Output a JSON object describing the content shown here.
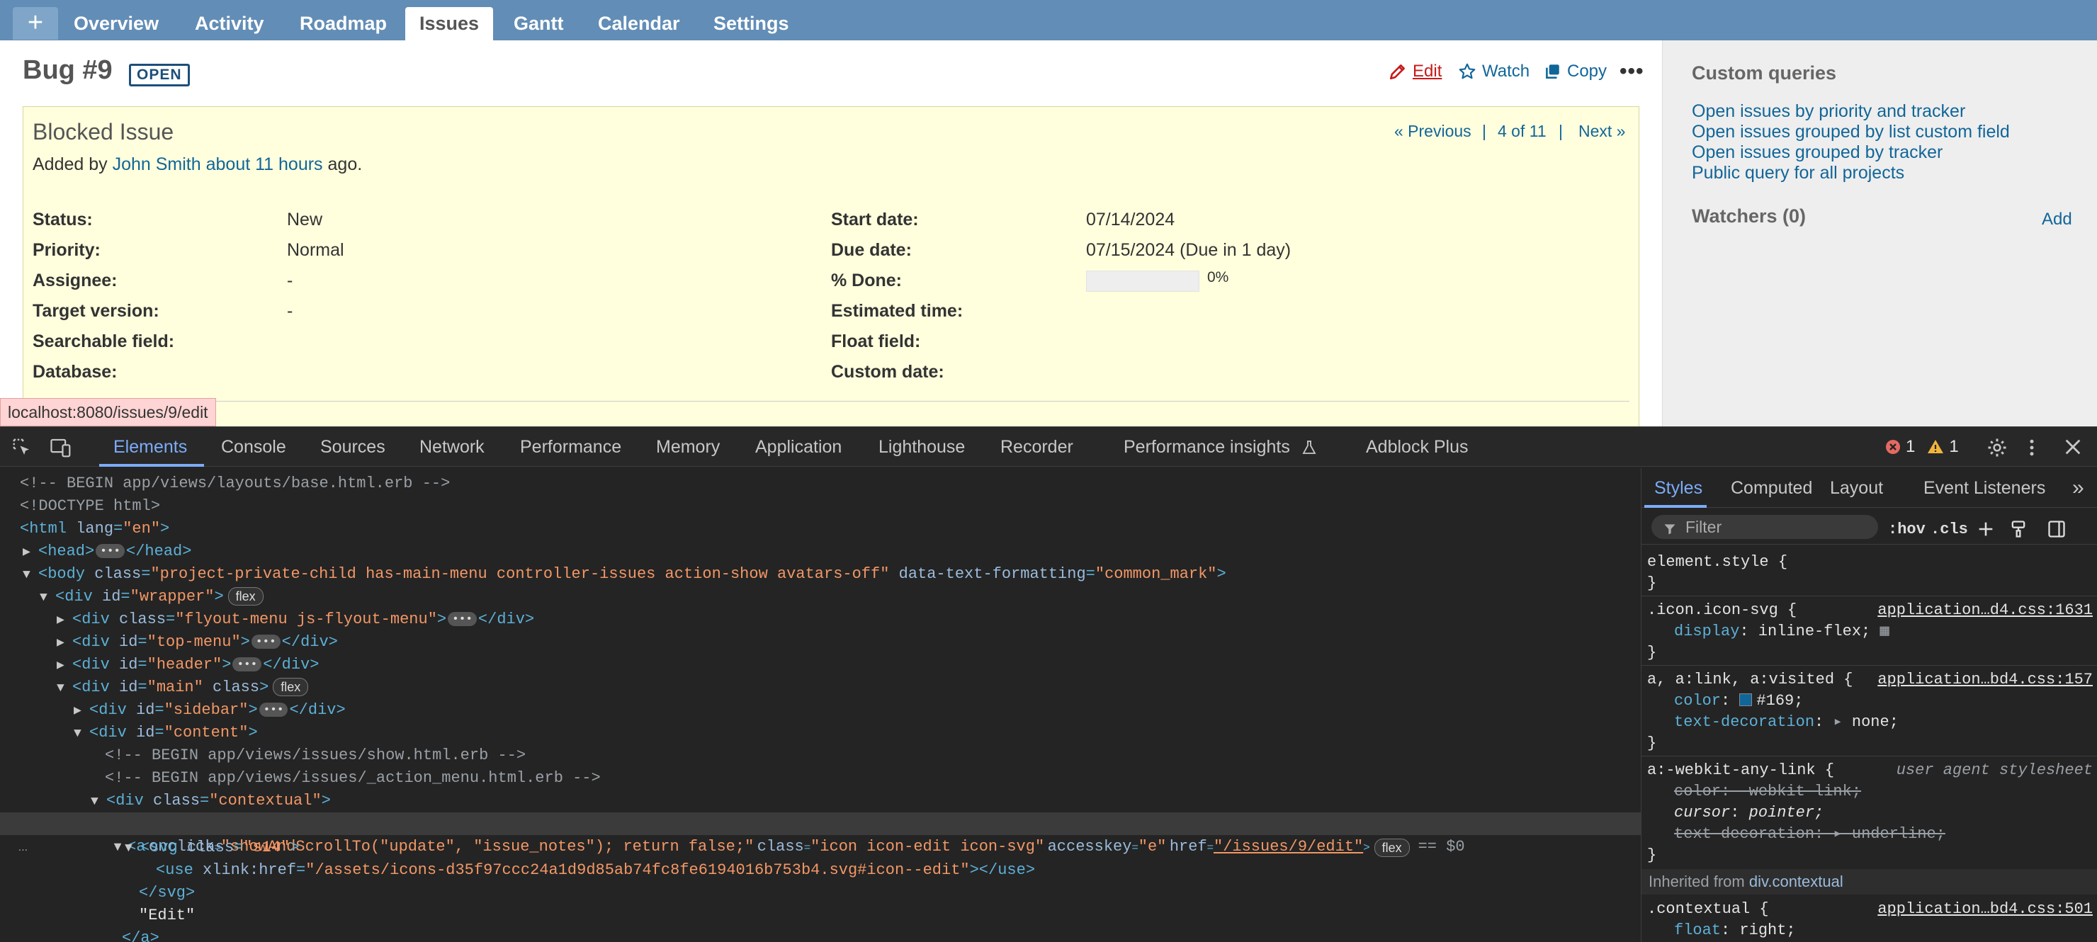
{
  "topmenu": {
    "plus": "+",
    "tabs": [
      "Overview",
      "Activity",
      "Roadmap",
      "Issues",
      "Gantt",
      "Calendar",
      "Settings"
    ],
    "selected": "Issues"
  },
  "issue": {
    "title": "Bug #9",
    "status_badge": "OPEN",
    "subject": "Blocked Issue",
    "added_by_prefix": "Added by",
    "author": "John Smith",
    "age": "about 11 hours",
    "age_suffix": "ago.",
    "actions": {
      "edit": "Edit",
      "watch": "Watch",
      "copy": "Copy",
      "more": "•••"
    },
    "nav": {
      "previous": "« Previous",
      "sep1": "|",
      "position": "4 of 11",
      "sep2": "|",
      "next": "Next »"
    },
    "attributes_left": [
      {
        "label": "Status:",
        "value": "New"
      },
      {
        "label": "Priority:",
        "value": "Normal"
      },
      {
        "label": "Assignee:",
        "value": "-"
      },
      {
        "label": "Target version:",
        "value": "-"
      },
      {
        "label": "Searchable field:",
        "value": ""
      },
      {
        "label": "Database:",
        "value": ""
      }
    ],
    "attributes_right": [
      {
        "label": "Start date:",
        "value": "07/14/2024"
      },
      {
        "label": "Due date:",
        "value": "07/15/2024 (Due in 1 day)"
      },
      {
        "label": "% Done:",
        "value": "0%"
      },
      {
        "label": "Estimated time:",
        "value": ""
      },
      {
        "label": "Float field:",
        "value": ""
      },
      {
        "label": "Custom date:",
        "value": ""
      }
    ],
    "done_fraction": 0
  },
  "sidebar": {
    "queries_heading": "Custom queries",
    "queries": [
      "Open issues by priority and tracker",
      "Open issues grouped by list custom field",
      "Open issues grouped by tracker",
      "Public query for all projects"
    ],
    "watchers_heading": "Watchers (0)",
    "watchers_add": "Add"
  },
  "status_url": "localhost:8080/issues/9/edit",
  "devtools": {
    "tabs": [
      "Elements",
      "Console",
      "Sources",
      "Network",
      "Performance",
      "Memory",
      "Application",
      "Lighthouse",
      "Recorder",
      "Performance insights",
      "Adblock Plus"
    ],
    "selected_tab": "Elements",
    "errors": "1",
    "warnings": "1",
    "dom": {
      "c1": "<!-- BEGIN app/views/layouts/base.html.erb -->",
      "doctype": "<!DOCTYPE html>",
      "html_tag": "<html",
      "html_attr": "lang",
      "html_val": "\"en\"",
      "head": "<head>",
      "head_close": "</head>",
      "body_open": "<body",
      "body_class_attr": "class",
      "body_class_val": "\"project-private-child has-main-menu controller-issues action-show avatars-off\"",
      "body_data_attr": "data-text-formatting",
      "body_data_val": "\"common_mark\"",
      "wrapper": "<div",
      "wrapper_attr": "id",
      "wrapper_val": "\"wrapper\"",
      "flex": "flex",
      "flyout_attr": "class",
      "flyout_val": "\"flyout-menu js-flyout-menu\"",
      "topmenu_val": "\"top-menu\"",
      "header_val": "\"header\"",
      "main_val": "\"main\"",
      "main_class": "class",
      "sidebar_val": "\"sidebar\"",
      "content_val": "\"content\"",
      "c2": "<!-- BEGIN app/views/issues/show.html.erb -->",
      "c3": "<!-- BEGIN app/views/issues/_action_menu.html.erb -->",
      "contextual_val": "\"contextual\"",
      "a_onclick_attr": "onclick",
      "a_onclick_val": "\"showAndScrollTo(\"update\", \"issue_notes\"); return false;\"",
      "a_class_attr": "class",
      "a_class_val": "\"icon icon-edit icon-svg\"",
      "a_key_attr": "accesskey",
      "a_key_val": "\"e\"",
      "a_href_attr": "href",
      "a_href_val": "\"/issues/9/edit\"",
      "eq": "== $0",
      "svg_attr": "class",
      "svg_val": "\"s14\"",
      "use_attr": "xlink:href",
      "use_val": "\"/assets/icons-d35f97ccc24a1d9d85ab74fc8fe6194016b753b4.svg#icon--edit\"",
      "svg_close": "</svg>",
      "edit_text": "\"Edit\"",
      "a_close": "</a>",
      "div_close": "</div>",
      "dots": "..."
    },
    "styles": {
      "tabs": [
        "Styles",
        "Computed",
        "Layout",
        "Event Listeners"
      ],
      "more": "»",
      "filter_placeholder": "Filter",
      "hov": ":hov",
      "cls": ".cls",
      "rules": {
        "element_style": "element.style {",
        "close": "}",
        "r1_sel": ".icon.icon-svg {",
        "r1_src": "application…d4.css:1631",
        "r1_prop": "display",
        "r1_val": "inline-flex;",
        "r2_sel": "a, a:link, a:visited {",
        "r2_src": "application…bd4.css:157",
        "r2_p1": "color",
        "r2_v1": "#169;",
        "r2_p2": "text-decoration",
        "r2_v2": "none;",
        "r3_sel": "a:-webkit-any-link {",
        "r3_src": "user agent stylesheet",
        "r3_p1": "color: -webkit-link;",
        "r3_p2": "cursor",
        "r3_v2": "pointer;",
        "r3_p3": "text-decoration: ▸ underline;",
        "inherited_prefix": "Inherited from",
        "inherited_cls": "div.contextual",
        "r4_sel": ".contextual {",
        "r4_src": "application…bd4.css:501",
        "r4_prop": "float",
        "r4_val": "right;"
      }
    }
  },
  "colors": {
    "menu_bg": "#628db6",
    "issue_bg": "#ffffdd",
    "link": "#116699",
    "edit": "#c61a1a",
    "devtools_bg": "#242424",
    "devtools_accent": "#7cacf8"
  }
}
